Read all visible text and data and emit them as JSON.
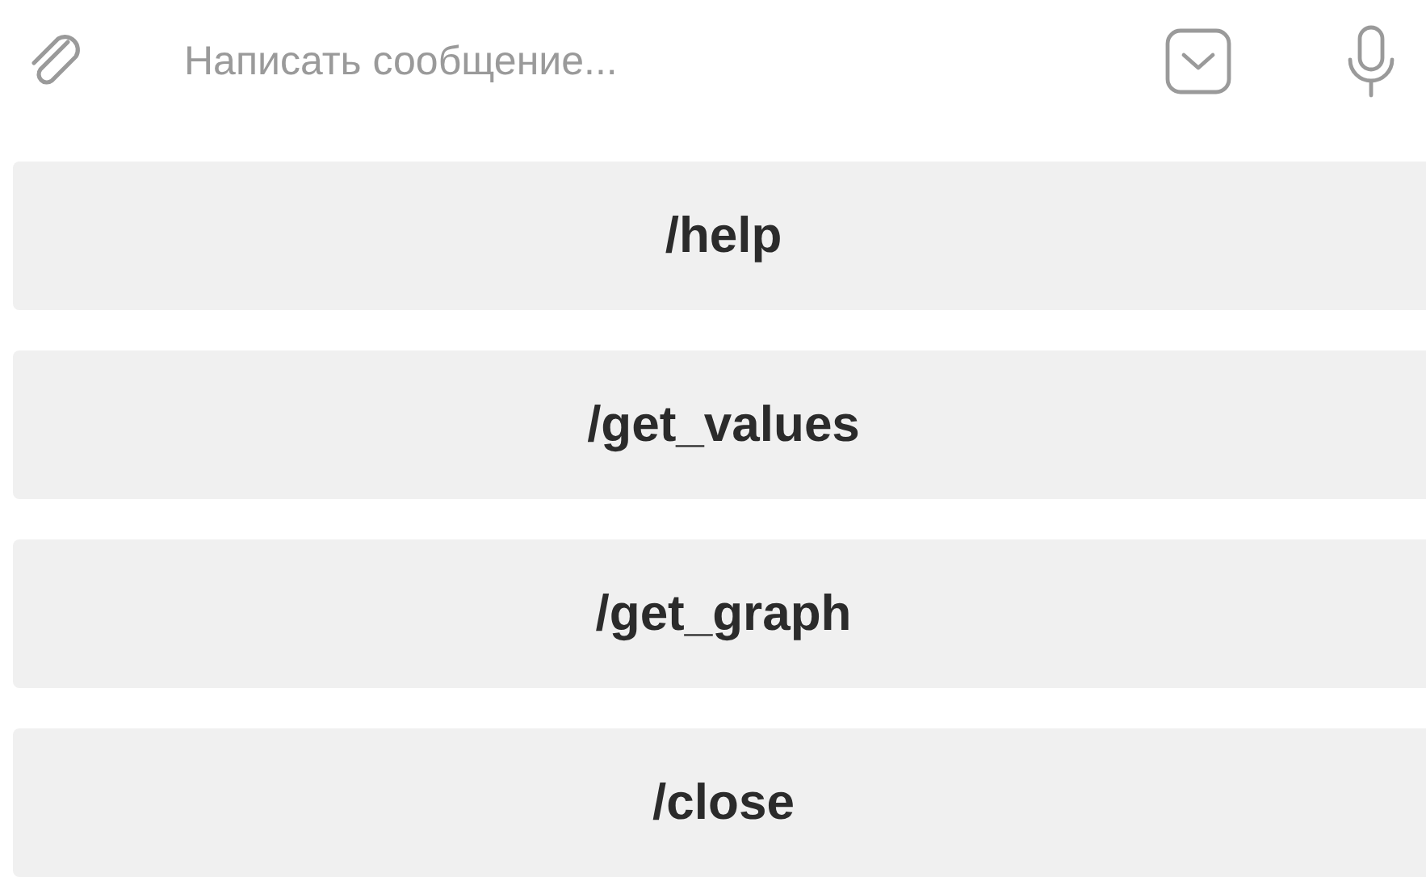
{
  "composer": {
    "placeholder": "Написать сообщение..."
  },
  "keyboard_buttons": [
    {
      "label": "/help"
    },
    {
      "label": "/get_values"
    },
    {
      "label": "/get_graph"
    },
    {
      "label": "/close"
    }
  ]
}
